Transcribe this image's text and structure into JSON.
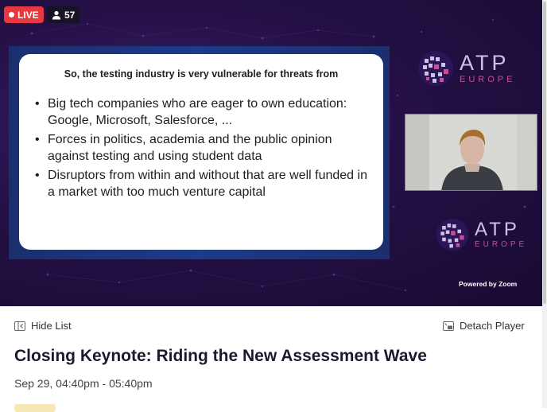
{
  "player": {
    "live_label": "LIVE",
    "viewer_count": "57",
    "slide": {
      "title": "So, the testing industry is very vulnerable for threats from",
      "bullets": [
        "Big tech companies who are eager to own education: Google, Microsoft, Salesforce, ...",
        "Forces in politics, academia and the public opinion against testing and using student data",
        "Disruptors from within and without that are well funded in a market with too much venture capital"
      ]
    },
    "logo_top": {
      "name": "ATP",
      "sub": "EUROPE"
    },
    "logo_bottom": {
      "name": "ATP",
      "sub": "EUROPE"
    },
    "powered_by": "Powered by Zoom"
  },
  "controls": {
    "hide_list_label": "Hide List",
    "detach_label": "Detach Player"
  },
  "session": {
    "title": "Closing Keynote: Riding the New Assessment Wave",
    "time": "Sep 29, 04:40pm - 05:40pm"
  },
  "colors": {
    "live_red": "#e5393f",
    "player_purple": "#241045",
    "logo_pink": "#cc4e93"
  }
}
